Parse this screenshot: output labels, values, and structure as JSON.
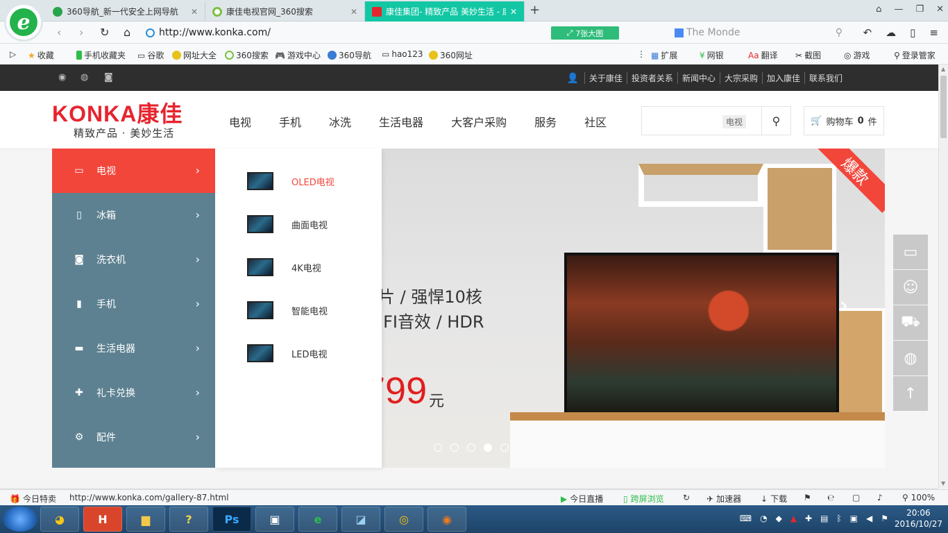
{
  "browser": {
    "tabs": [
      {
        "label": "360导航_新一代安全上网导航",
        "active": false
      },
      {
        "label": "康佳电视官网_360搜索",
        "active": false
      },
      {
        "label": "康佳集团- 精致产品 美妙生活 - 康",
        "active": true
      }
    ],
    "url": "http://www.konka.com/",
    "big_image_label": "7张大图",
    "search_text": "The Monde",
    "favorites": [
      "收藏",
      "手机收藏夹",
      "谷歌",
      "网址大全",
      "360搜索",
      "游戏中心",
      "360导航",
      "hao123",
      "360网址"
    ],
    "favorites_right": [
      "扩展",
      "网银",
      "翻译",
      "截图",
      "游戏",
      "登录管家"
    ]
  },
  "site": {
    "top_links": [
      "关于康佳",
      "投资者关系",
      "新闻中心",
      "大宗采购",
      "加入康佳",
      "联系我们"
    ],
    "logo": {
      "text": "KONKA康佳",
      "slogan": "精致产品 · 美妙生活"
    },
    "nav": [
      "电视",
      "手机",
      "冰洗",
      "生活电器",
      "大客户采购",
      "服务",
      "社区"
    ],
    "search": {
      "tag": "电视"
    },
    "cart": {
      "label": "购物车",
      "count": "0",
      "unit": "件"
    },
    "categories": [
      {
        "label": "电视",
        "icon": "tv-icon",
        "active": true
      },
      {
        "label": "冰箱",
        "icon": "fridge-icon",
        "active": false
      },
      {
        "label": "洗衣机",
        "icon": "washer-icon",
        "active": false
      },
      {
        "label": "手机",
        "icon": "phone-icon",
        "active": false
      },
      {
        "label": "生活电器",
        "icon": "appliance-icon",
        "active": false
      },
      {
        "label": "礼卡兑换",
        "icon": "gift-icon",
        "active": false
      },
      {
        "label": "配件",
        "icon": "gear-icon",
        "active": false
      }
    ],
    "tv_submenu": [
      {
        "label": "OLED电视",
        "active": true
      },
      {
        "label": "曲面电视",
        "active": false
      },
      {
        "label": "4K电视",
        "active": false
      },
      {
        "label": "智能电视",
        "active": false
      },
      {
        "label": "LED电视",
        "active": false
      }
    ],
    "banner": {
      "line1": "片 / 强悍10核",
      "line2": "IFI音效 / HDR",
      "price": "799",
      "unit": "元",
      "ribbon": "爆款",
      "slide_count": 5,
      "active_slide": 4
    }
  },
  "statusbar": {
    "left_label": "今日特卖",
    "hover_url": "http://www.konka.com/gallery-87.html",
    "items": [
      "今日直播",
      "跨屏浏览",
      "加速器",
      "下载"
    ],
    "zoom": "100%"
  },
  "taskbar": {
    "time": "20:06",
    "date": "2016/10/27"
  },
  "colors": {
    "brand_red": "#e6252f",
    "menu_bg": "#5d8191",
    "active_red": "#f2463b",
    "tab_active": "#13c7a5"
  }
}
